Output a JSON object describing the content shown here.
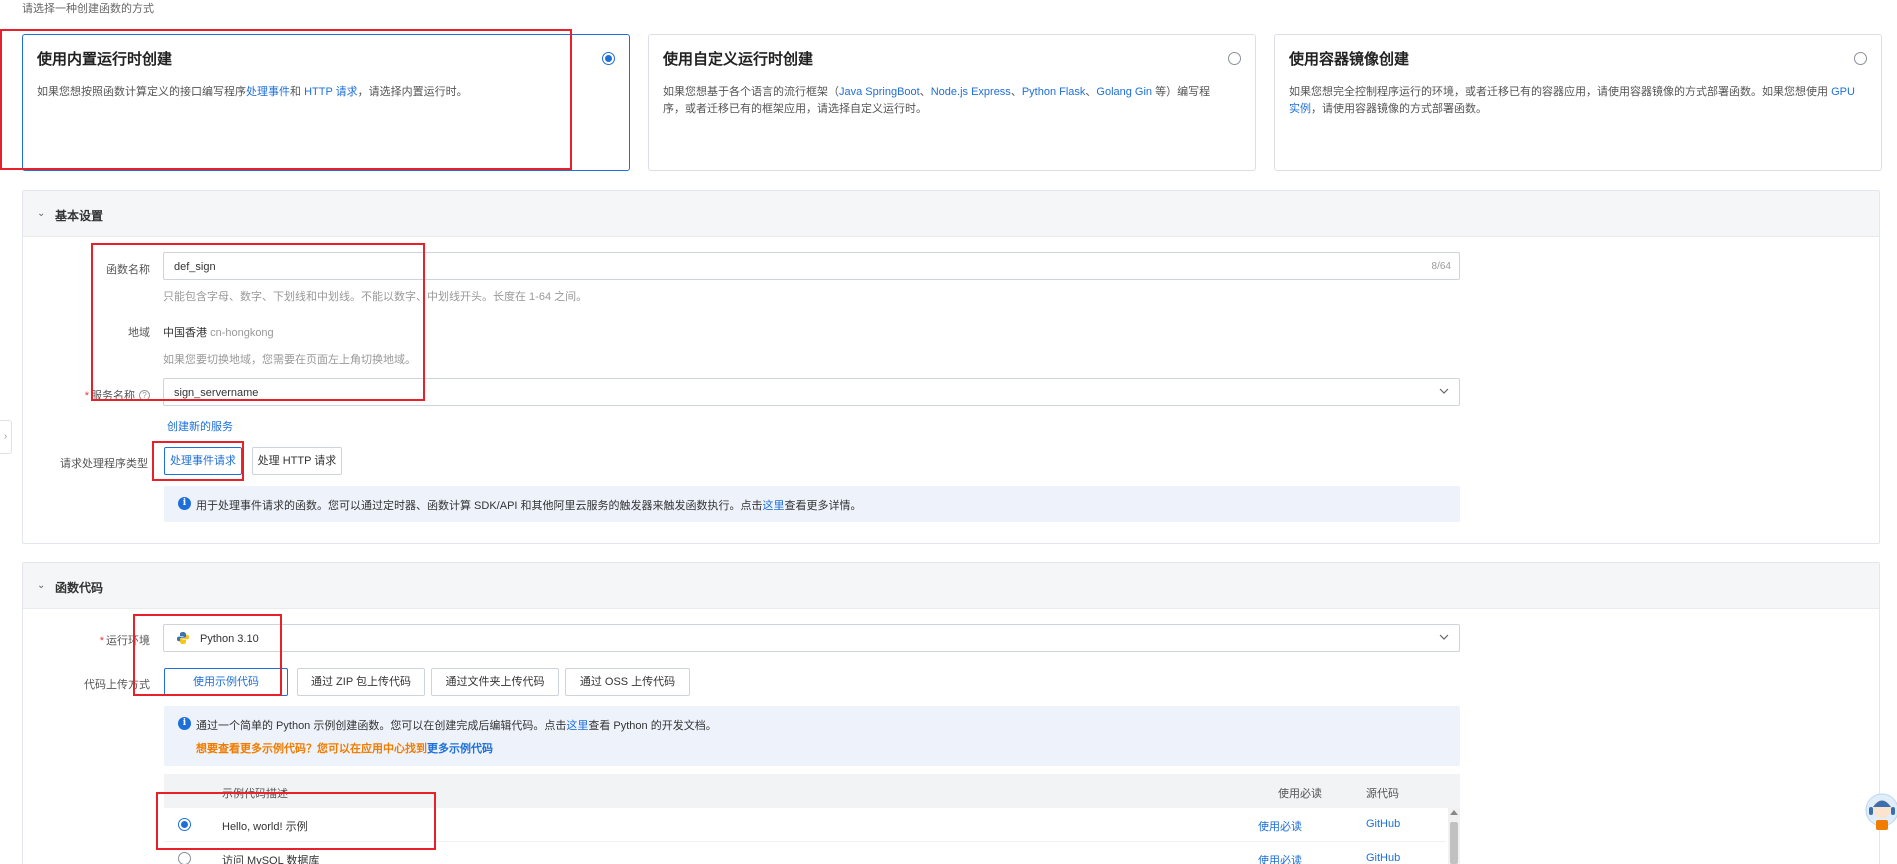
{
  "page": {
    "hint": "请选择一种创建函数的方式"
  },
  "modes": [
    {
      "title": "使用内置运行时创建",
      "desc_parts": [
        "如果您想按照函数计算定义的接口编写程序",
        "处理事件",
        "和 ",
        "HTTP 请求",
        "，请选择内置运行时。"
      ],
      "selected": true
    },
    {
      "title": "使用自定义运行时创建",
      "desc_parts": [
        "如果您想基于各个语言的流行框架（",
        "Java SpringBoot",
        "、",
        "Node.js Express",
        "、",
        "Python Flask",
        "、",
        "Golang Gin",
        " 等）编写程序，或者迁移已有的框架应用，请选择自定义运行时。"
      ],
      "selected": false
    },
    {
      "title": "使用容器镜像创建",
      "desc_parts": [
        "如果您想完全控制程序运行的环境，或者迁移已有的容器应用，请使用容器镜像的方式部署函数。如果您想使用 ",
        "GPU 实例",
        "，请使用容器镜像的方式部署函数。"
      ],
      "selected": false
    }
  ],
  "basic": {
    "title": "基本设置",
    "func_name_label": "函数名称",
    "func_name_value": "def_sign",
    "func_name_counter": "8/64",
    "func_name_hint": "只能包含字母、数字、下划线和中划线。不能以数字、中划线开头。长度在 1-64 之间。",
    "region_label": "地域",
    "region_value": "中国香港",
    "region_code": "cn-hongkong",
    "region_hint": "如果您要切换地域，您需要在页面左上角切换地域。",
    "service_label": "服务名称",
    "service_value": "sign_servername",
    "create_service_link": "创建新的服务",
    "handler_type_label": "请求处理程序类型",
    "handler_event_btn": "处理事件请求",
    "handler_http_btn": "处理 HTTP 请求",
    "info_prefix": "用于处理事件请求的函数。您可以通过定时器、函数计算 SDK/API 和其他阿里云服务的触发器来触发函数执行。点击",
    "info_link": "这里",
    "info_suffix": "查看更多详情。"
  },
  "code": {
    "title": "函数代码",
    "runtime_label": "运行环境",
    "runtime_value": "Python 3.10",
    "upload_label": "代码上传方式",
    "upload_options": [
      "使用示例代码",
      "通过 ZIP 包上传代码",
      "通过文件夹上传代码",
      "通过 OSS 上传代码"
    ],
    "info_prefix": "通过一个简单的 Python 示例创建函数。您可以在创建完成后编辑代码。点击",
    "info_link": "这里",
    "info_suffix": "查看 Python 的开发文档。",
    "info_orange_prefix": "想要查看更多示例代码？您可以在应用中心找到",
    "info_orange_link": "更多示例代码",
    "table": {
      "columns": [
        "示例代码描述",
        "使用必读",
        "源代码"
      ],
      "rows": [
        {
          "desc": "Hello, world! 示例",
          "guide": "使用必读",
          "source": "GitHub",
          "selected": true
        },
        {
          "desc": "访问 MySQL 数据库",
          "guide": "使用必读",
          "source": "GitHub",
          "selected": false
        }
      ]
    }
  },
  "colors": {
    "primary": "#1e6fd9",
    "highlight_box": "#e8202a",
    "warning": "#f07c00"
  },
  "icons": {
    "section_toggle": "chevron-down-icon",
    "select_caret": "chevron-down-icon",
    "info": "info-icon",
    "help": "help-circle-icon",
    "runtime": "python-logo-icon",
    "sidebar_toggle": "chevron-right-icon",
    "assistant": "assistant-avatar-icon"
  }
}
